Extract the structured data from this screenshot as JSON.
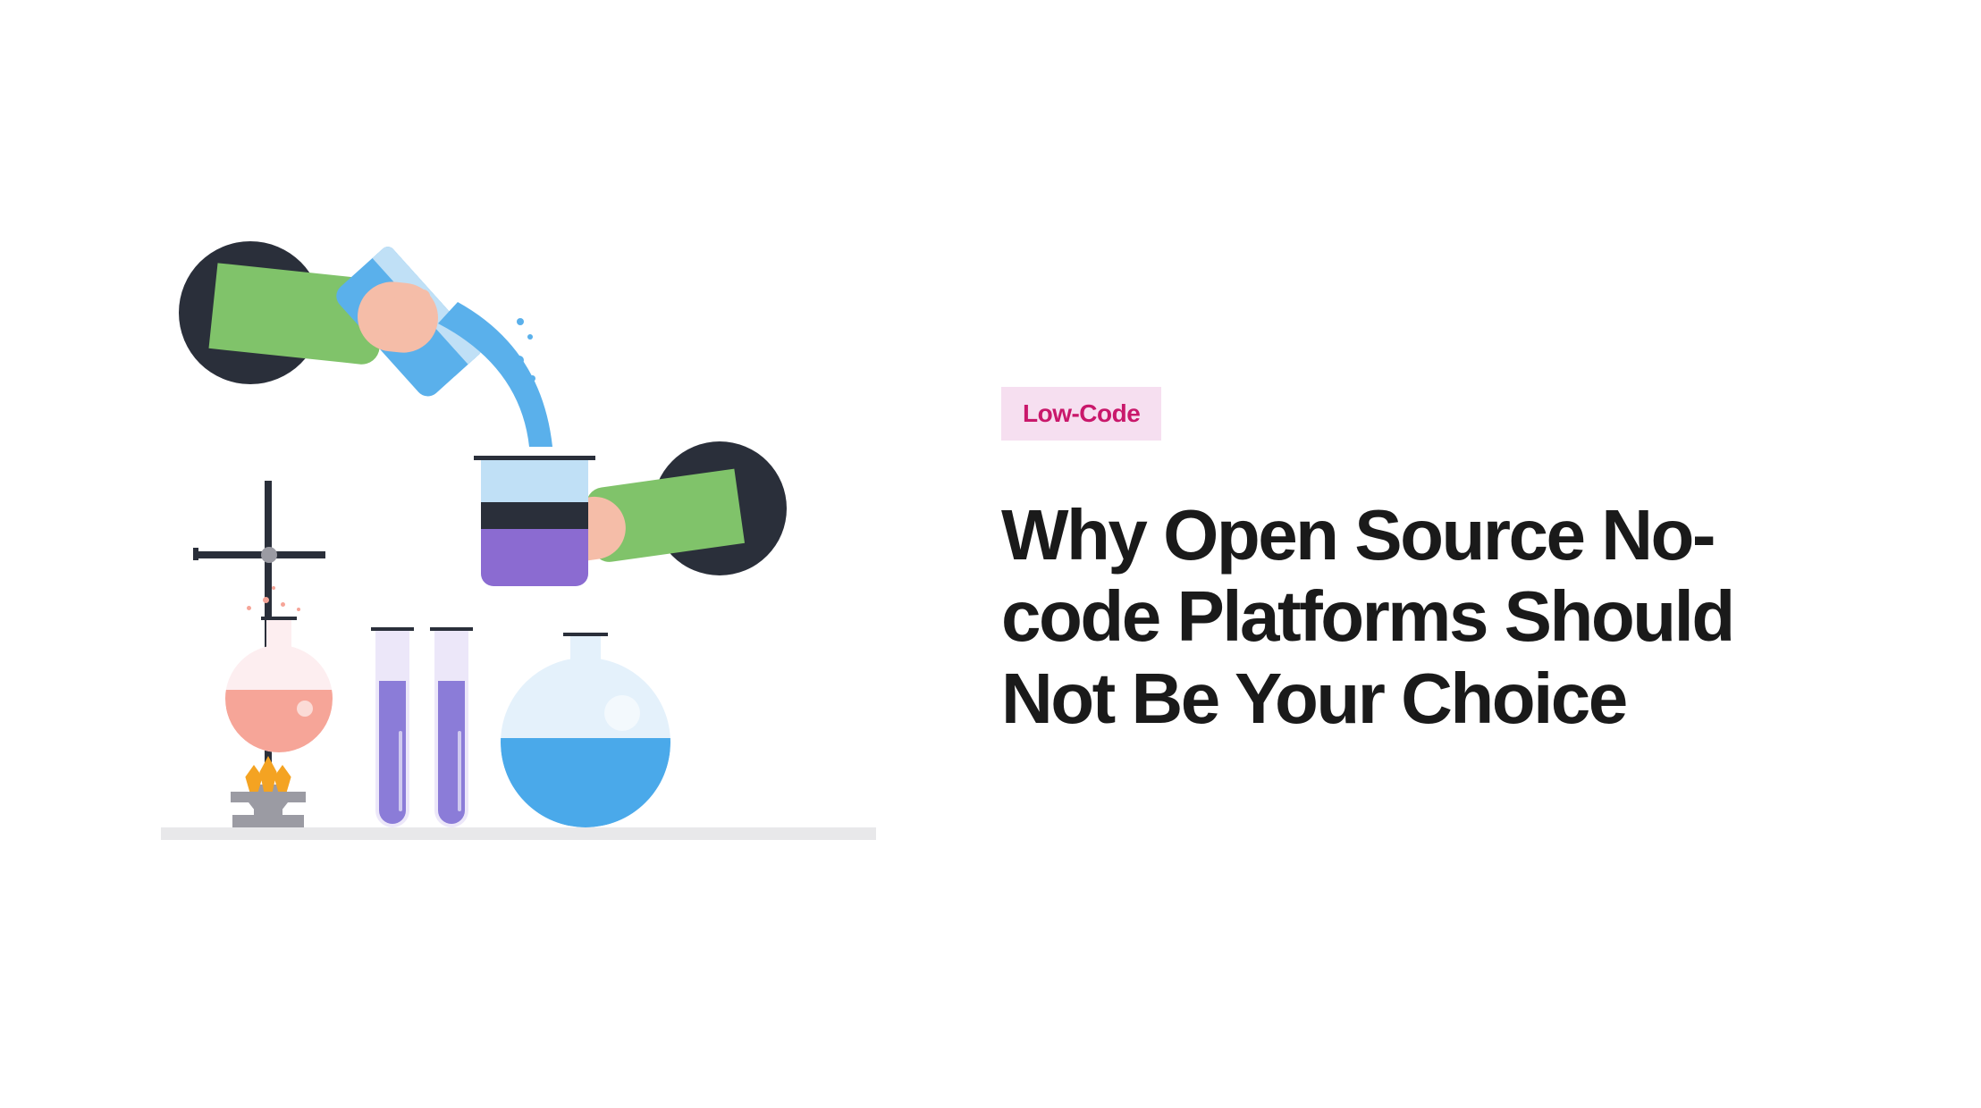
{
  "tag": {
    "label": "Low-Code"
  },
  "heading": {
    "text": "Why Open Source No-code Platforms Should Not Be Your Choice"
  },
  "colors": {
    "tag_bg": "#f6dff0",
    "tag_text": "#c9186b",
    "heading_text": "#1a1a1a",
    "blue": "#5ab0eb",
    "purple": "#8b6bd1",
    "green": "#80c36a",
    "skin": "#f5bda8",
    "dark": "#2a2f3a",
    "pink": "#f6a598",
    "orange": "#f4a322",
    "gray": "#9b9ba3"
  },
  "illustration": {
    "description": "Chemistry lab scene: two arms from dark portals pouring liquid between beakers, round flasks and test tubes on a table over a burner",
    "icons": [
      "beaker-icon",
      "flask-icon",
      "test-tube-icon",
      "burner-icon",
      "hand-icon"
    ]
  }
}
